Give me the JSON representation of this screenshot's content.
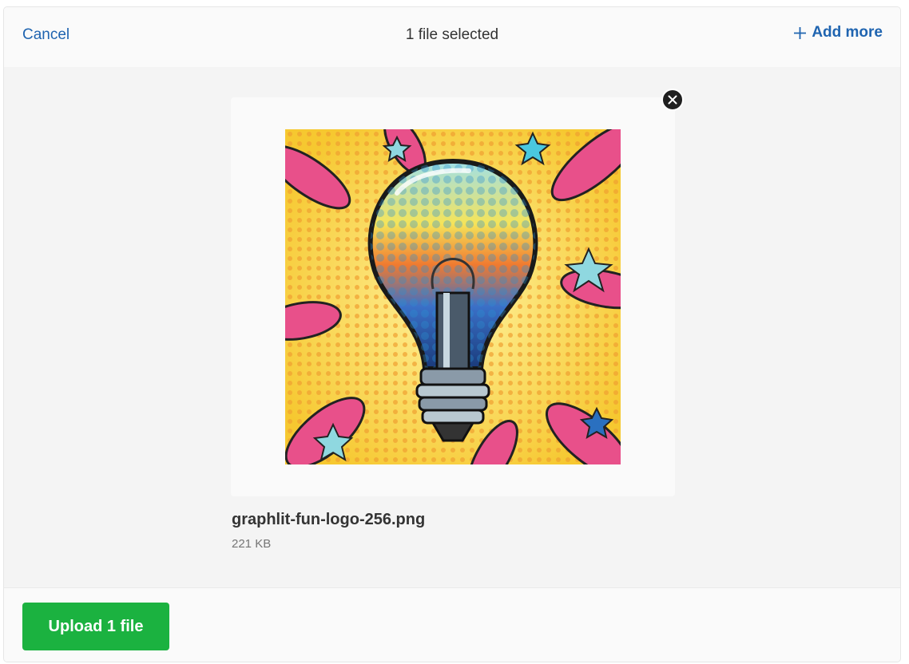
{
  "header": {
    "cancel_label": "Cancel",
    "title": "1 file selected",
    "add_more_label": "Add more"
  },
  "file": {
    "name": "graphlit-fun-logo-256.png",
    "size": "221 KB",
    "preview_icon": "lightbulb-pop-art-image"
  },
  "footer": {
    "upload_label": "Upload 1 file"
  },
  "colors": {
    "accent": "#1f64b0",
    "upload_button": "#1bb240",
    "remove_button": "#1f1f1f"
  }
}
